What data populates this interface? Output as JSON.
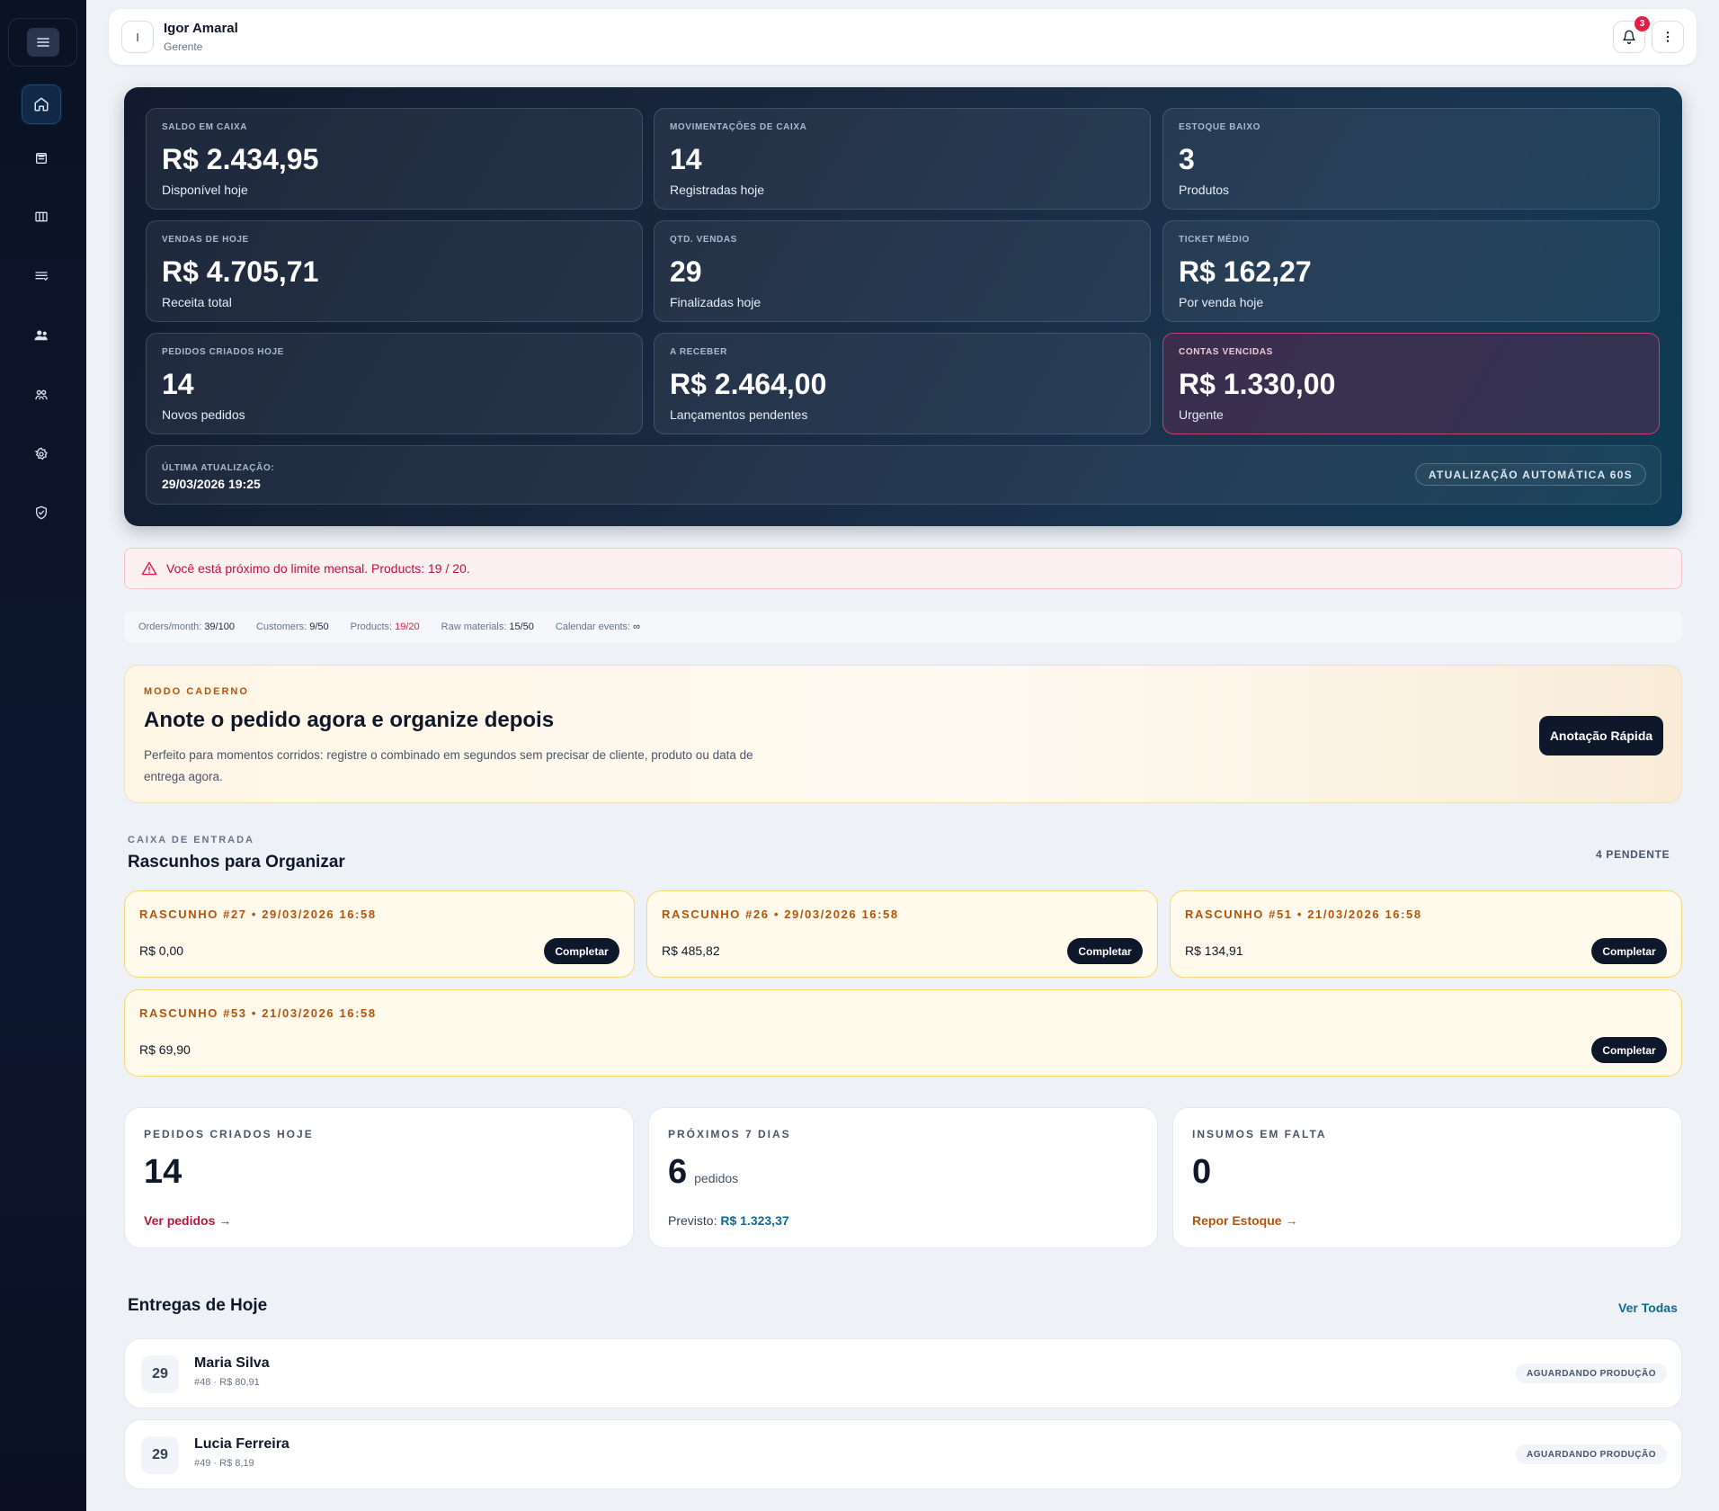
{
  "sidebar": {
    "menu_icon": "hamburger-icon",
    "items": [
      {
        "name": "home",
        "icon": "home-icon",
        "active": true
      },
      {
        "name": "orders",
        "icon": "receipt-icon"
      },
      {
        "name": "catalog",
        "icon": "columns-icon"
      },
      {
        "name": "lists",
        "icon": "list-icon"
      },
      {
        "name": "customers",
        "icon": "users-icon"
      },
      {
        "name": "team",
        "icon": "team-icon"
      },
      {
        "name": "settings",
        "icon": "gear-icon"
      },
      {
        "name": "security",
        "icon": "shield-icon"
      }
    ]
  },
  "user": {
    "initial": "I",
    "name": "Igor Amaral",
    "role": "Gerente"
  },
  "notifications": {
    "count": "3"
  },
  "kpis": [
    {
      "label": "SALDO EM CAIXA",
      "value": "R$ 2.434,95",
      "sub": "Disponível hoje"
    },
    {
      "label": "MOVIMENTAÇÕES DE CAIXA",
      "value": "14",
      "sub": "Registradas hoje"
    },
    {
      "label": "ESTOQUE BAIXO",
      "value": "3",
      "sub": "Produtos"
    },
    {
      "label": "VENDAS DE HOJE",
      "value": "R$ 4.705,71",
      "sub": "Receita total"
    },
    {
      "label": "QTD. VENDAS",
      "value": "29",
      "sub": "Finalizadas hoje"
    },
    {
      "label": "TICKET MÉDIO",
      "value": "R$ 162,27",
      "sub": "Por venda hoje"
    },
    {
      "label": "PEDIDOS CRIADOS HOJE",
      "value": "14",
      "sub": "Novos pedidos"
    },
    {
      "label": "A RECEBER",
      "value": "R$ 2.464,00",
      "sub": "Lançamentos pendentes"
    },
    {
      "label": "CONTAS VENCIDAS",
      "value": "R$ 1.330,00",
      "sub": "Urgente"
    }
  ],
  "update": {
    "label": "ÚLTIMA ATUALIZAÇÃO:",
    "value": "29/03/2026 19:25",
    "auto": "ATUALIZAÇÃO AUTOMÁTICA 60S"
  },
  "alert": {
    "text": "Você está próximo do limite mensal. Products: 19 / 20."
  },
  "limits": [
    {
      "label": "Orders/month:",
      "value": "39/100"
    },
    {
      "label": "Customers:",
      "value": "9/50"
    },
    {
      "label": "Products:",
      "value": "19/20"
    },
    {
      "label": "Raw materials:",
      "value": "15/50"
    },
    {
      "label": "Calendar events:",
      "value": "∞"
    }
  ],
  "notebook": {
    "eyebrow": "MODO CADERNO",
    "title": "Anote o pedido agora e organize depois",
    "description": "Perfeito para momentos corridos: registre o combinado em segundos sem precisar de cliente, produto ou data de entrega agora.",
    "button": "Anotação Rápida"
  },
  "inbox": {
    "eyebrow": "CAIXA DE ENTRADA",
    "title": "Rascunhos para Organizar",
    "count": "4 PENDENTE",
    "drafts": [
      {
        "title": "RASCUNHO #27 • 29/03/2026 16:58",
        "amount": "R$ 0,00",
        "button": "Completar"
      },
      {
        "title": "RASCUNHO #26 • 29/03/2026 16:58",
        "amount": "R$ 485,82",
        "button": "Completar"
      },
      {
        "title": "RASCUNHO #51 • 21/03/2026 16:58",
        "amount": "R$ 134,91",
        "button": "Completar"
      },
      {
        "title": "RASCUNHO #53 • 21/03/2026 16:58",
        "amount": "R$ 69,90",
        "button": "Completar"
      }
    ]
  },
  "stats": [
    {
      "label": "PEDIDOS CRIADOS HOJE",
      "value": "14",
      "unit": "",
      "link": "Ver pedidos →"
    },
    {
      "label": "PRÓXIMOS 7 DIAS",
      "value": "6",
      "unit": "pedidos",
      "forecast_label": "Previsto:",
      "forecast_value": "R$ 1.323,37"
    },
    {
      "label": "INSUMOS EM FALTA",
      "value": "0",
      "unit": "",
      "link": "Repor Estoque →"
    }
  ],
  "deliveries": {
    "title": "Entregas de Hoje",
    "view_all": "Ver Todas",
    "items": [
      {
        "day": "29",
        "name": "Maria Silva",
        "meta": "#48 · R$ 80,91",
        "status": "AGUARDANDO PRODUÇÃO"
      },
      {
        "day": "29",
        "name": "Lucia Ferreira",
        "meta": "#49 · R$ 8,19",
        "status": "AGUARDANDO PRODUÇÃO"
      }
    ]
  },
  "colors": {
    "accent": "#0f172a",
    "danger": "#e11d48",
    "warning": "#b45309",
    "link_blue": "#0e6a93"
  }
}
